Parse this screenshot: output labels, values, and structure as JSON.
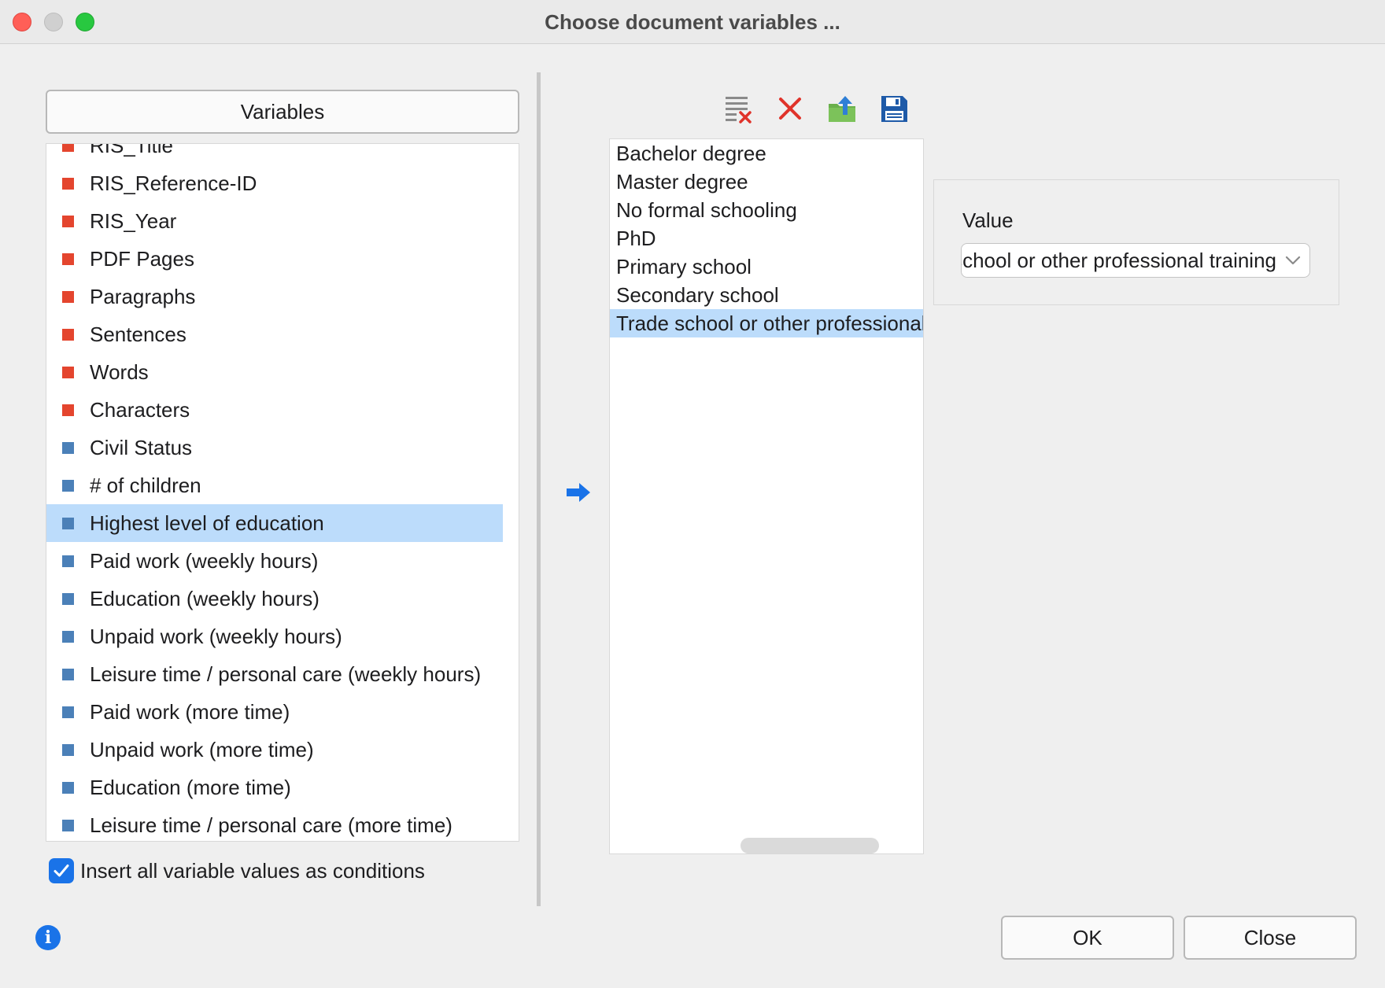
{
  "window": {
    "title": "Choose document variables ..."
  },
  "variables": {
    "header_label": "Variables",
    "items": [
      {
        "label": "RIS_Title",
        "type": "system",
        "color": "#e4452e"
      },
      {
        "label": "RIS_Reference-ID",
        "type": "system",
        "color": "#e4452e"
      },
      {
        "label": "RIS_Year",
        "type": "system",
        "color": "#e4452e"
      },
      {
        "label": "PDF Pages",
        "type": "system",
        "color": "#e4452e"
      },
      {
        "label": "Paragraphs",
        "type": "system",
        "color": "#e4452e"
      },
      {
        "label": "Sentences",
        "type": "system",
        "color": "#e4452e"
      },
      {
        "label": "Words",
        "type": "system",
        "color": "#e4452e"
      },
      {
        "label": "Characters",
        "type": "system",
        "color": "#e4452e"
      },
      {
        "label": "Civil Status",
        "type": "user",
        "color": "#4b80b8"
      },
      {
        "label": "# of children",
        "type": "user",
        "color": "#4b80b8"
      },
      {
        "label": "Highest level of education",
        "type": "user",
        "color": "#4b80b8",
        "selected": true
      },
      {
        "label": "Paid work (weekly hours)",
        "type": "user",
        "color": "#4b80b8"
      },
      {
        "label": "Education (weekly hours)",
        "type": "user",
        "color": "#4b80b8"
      },
      {
        "label": "Unpaid work (weekly hours)",
        "type": "user",
        "color": "#4b80b8"
      },
      {
        "label": "Leisure time / personal care (weekly hours)",
        "type": "user",
        "color": "#4b80b8"
      },
      {
        "label": "Paid work (more time)",
        "type": "user",
        "color": "#4b80b8"
      },
      {
        "label": "Unpaid work (more time)",
        "type": "user",
        "color": "#4b80b8"
      },
      {
        "label": "Education (more time)",
        "type": "user",
        "color": "#4b80b8"
      },
      {
        "label": "Leisure time / personal care (more time)",
        "type": "user",
        "color": "#4b80b8"
      }
    ]
  },
  "options": {
    "insert_all_label": "Insert all variable values as conditions",
    "insert_all_checked": true
  },
  "toolbar": {
    "icons": [
      "clear-list-icon",
      "delete-icon",
      "export-icon",
      "save-icon"
    ]
  },
  "values": {
    "items": [
      {
        "label": "Bachelor degree"
      },
      {
        "label": "Master degree"
      },
      {
        "label": "No formal schooling"
      },
      {
        "label": "PhD"
      },
      {
        "label": "Primary school"
      },
      {
        "label": "Secondary school"
      },
      {
        "label": "Trade school or other professional training",
        "selected": true
      }
    ]
  },
  "value_panel": {
    "label": "Value",
    "selected_value": "Trade school or other professional training"
  },
  "buttons": {
    "ok_label": "OK",
    "close_label": "Close"
  },
  "colors": {
    "selection": "#bcdcfb",
    "accent": "#1a73e8",
    "system_var": "#e4452e",
    "user_var": "#4b80b8"
  }
}
